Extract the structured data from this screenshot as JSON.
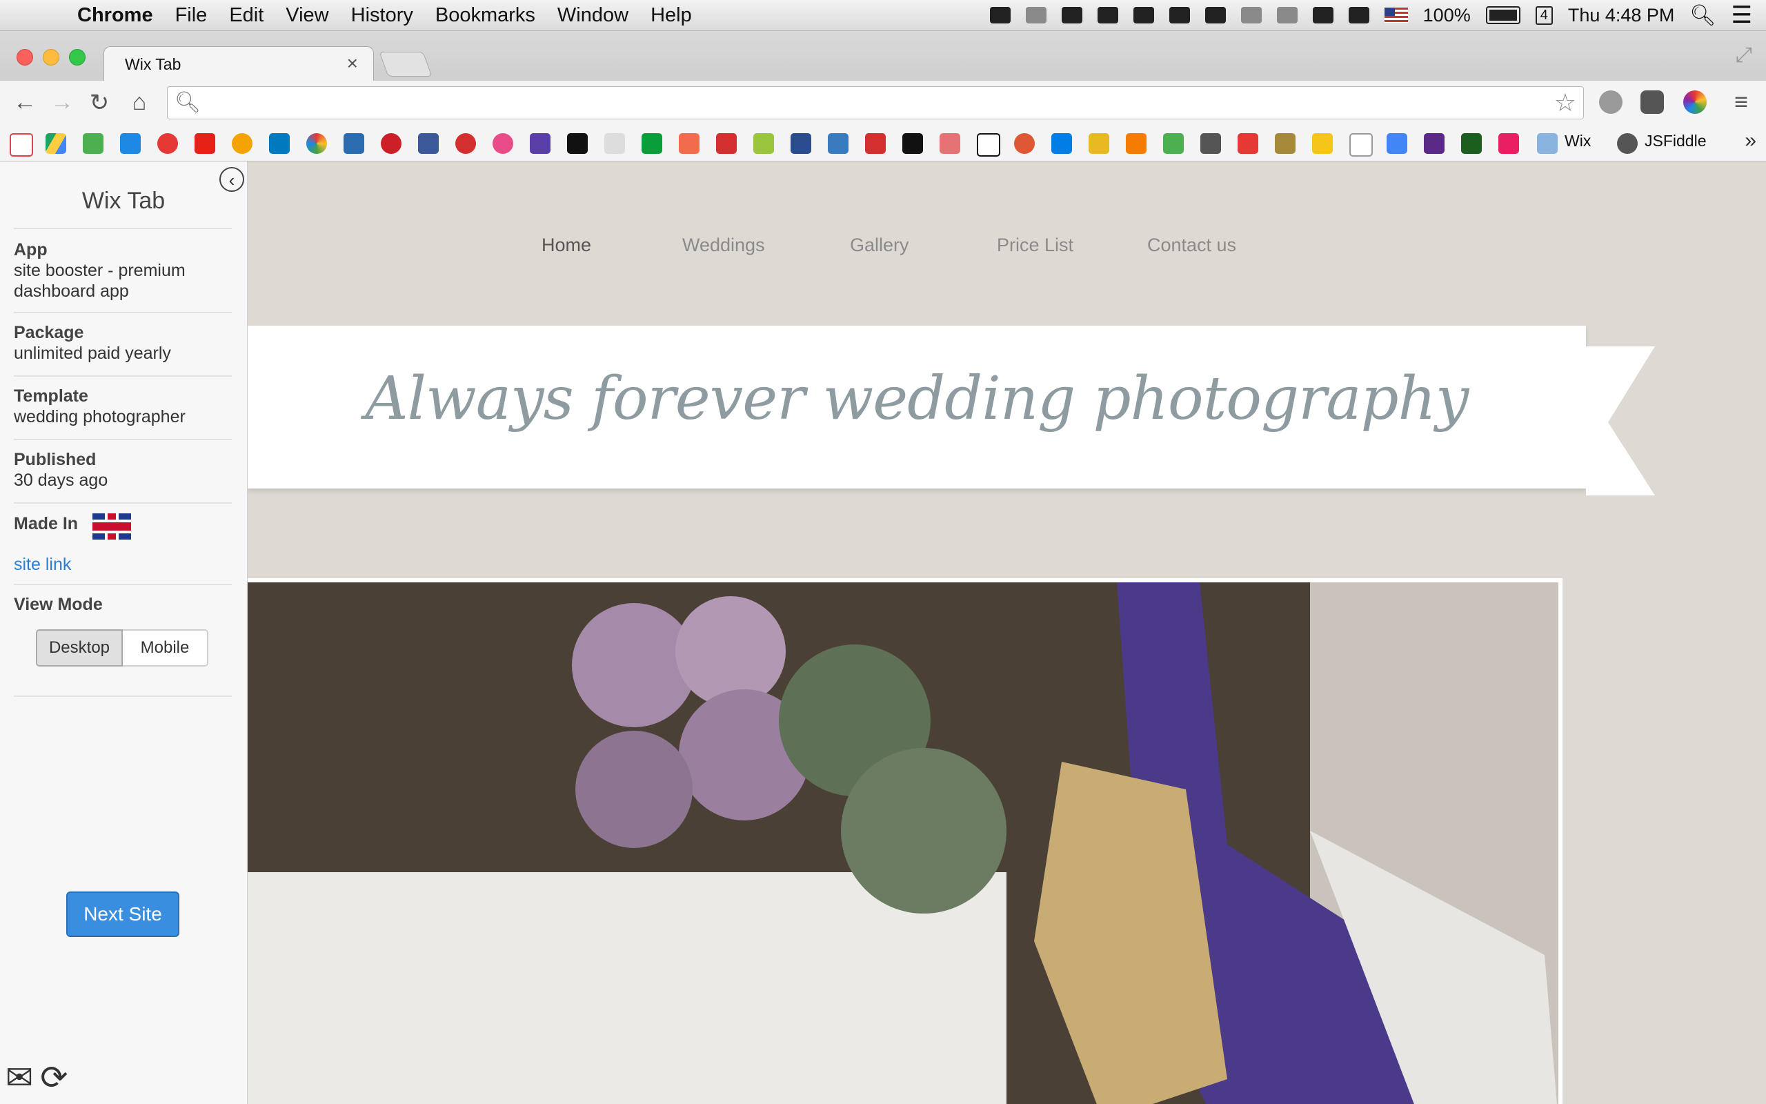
{
  "menubar": {
    "app": "Chrome",
    "items": [
      "File",
      "Edit",
      "View",
      "History",
      "Bookmarks",
      "Window",
      "Help"
    ],
    "battery": "100%",
    "clock": "Thu 4:48 PM",
    "calendar_day": "4"
  },
  "browser": {
    "tab_title": "Wix Tab",
    "tab_close": "×",
    "url": "",
    "bookmark_labels": [
      "Wix",
      "JSFiddle"
    ]
  },
  "sidebar": {
    "title": "Wix Tab",
    "app_label": "App",
    "app_value": "site booster - premium dashboard app",
    "package_label": "Package",
    "package_value": "unlimited paid yearly",
    "template_label": "Template",
    "template_value": "wedding photographer",
    "published_label": "Published",
    "published_value": "30 days ago",
    "made_in_label": "Made In",
    "site_link": "site link",
    "view_mode_label": "View Mode",
    "view_modes": [
      "Desktop",
      "Mobile"
    ],
    "next_button": "Next Site"
  },
  "site": {
    "nav": [
      "Home",
      "Weddings",
      "Gallery",
      "Price List",
      "Contact us"
    ],
    "banner_title": "Always forever wedding photography"
  },
  "colors": {
    "site_bg": "#dedad3",
    "banner_text": "#8e9ca1",
    "primary_button": "#3a8ee0",
    "link": "#2f7fd0"
  }
}
